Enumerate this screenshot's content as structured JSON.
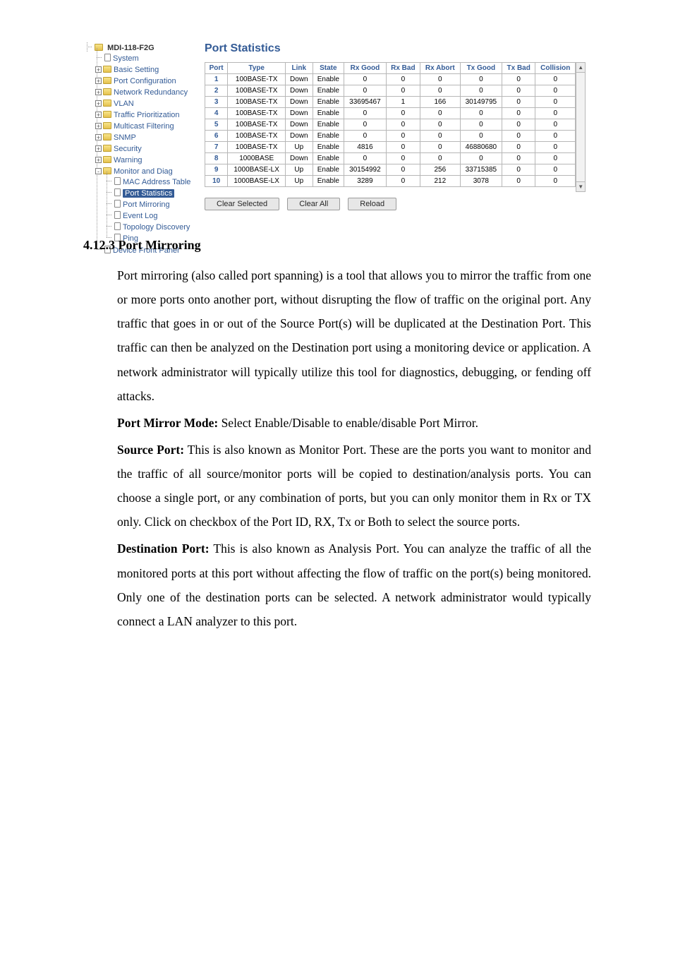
{
  "ui": {
    "product": "MDI-118-F2G",
    "title": "Port Statistics",
    "tree": {
      "root": "MDI-118-F2G",
      "items": [
        {
          "label": "System",
          "icon": "doc"
        },
        {
          "label": "Basic Setting",
          "icon": "folder",
          "exp": "+"
        },
        {
          "label": "Port Configuration",
          "icon": "folder",
          "exp": "+"
        },
        {
          "label": "Network Redundancy",
          "icon": "folder",
          "exp": "+"
        },
        {
          "label": "VLAN",
          "icon": "folder",
          "exp": "+"
        },
        {
          "label": "Traffic Prioritization",
          "icon": "folder",
          "exp": "+"
        },
        {
          "label": "Multicast Filtering",
          "icon": "folder",
          "exp": "+"
        },
        {
          "label": "SNMP",
          "icon": "folder",
          "exp": "+"
        },
        {
          "label": "Security",
          "icon": "folder",
          "exp": "+"
        },
        {
          "label": "Warning",
          "icon": "folder",
          "exp": "+"
        },
        {
          "label": "Monitor and Diag",
          "icon": "folder",
          "exp": "-",
          "children": [
            {
              "label": "MAC Address Table",
              "icon": "doc"
            },
            {
              "label": "Port Statistics",
              "icon": "doc",
              "selected": true
            },
            {
              "label": "Port Mirroring",
              "icon": "doc"
            },
            {
              "label": "Event Log",
              "icon": "doc"
            },
            {
              "label": "Topology Discovery",
              "icon": "doc"
            },
            {
              "label": "Ping",
              "icon": "doc"
            }
          ]
        },
        {
          "label": "Device Front Panel",
          "icon": "doc"
        }
      ]
    },
    "columns": [
      "Port",
      "Type",
      "Link",
      "State",
      "Rx Good",
      "Rx Bad",
      "Rx Abort",
      "Tx Good",
      "Tx Bad",
      "Collision"
    ],
    "rows": [
      [
        "1",
        "100BASE-TX",
        "Down",
        "Enable",
        "0",
        "0",
        "0",
        "0",
        "0",
        "0"
      ],
      [
        "2",
        "100BASE-TX",
        "Down",
        "Enable",
        "0",
        "0",
        "0",
        "0",
        "0",
        "0"
      ],
      [
        "3",
        "100BASE-TX",
        "Down",
        "Enable",
        "33695467",
        "1",
        "166",
        "30149795",
        "0",
        "0"
      ],
      [
        "4",
        "100BASE-TX",
        "Down",
        "Enable",
        "0",
        "0",
        "0",
        "0",
        "0",
        "0"
      ],
      [
        "5",
        "100BASE-TX",
        "Down",
        "Enable",
        "0",
        "0",
        "0",
        "0",
        "0",
        "0"
      ],
      [
        "6",
        "100BASE-TX",
        "Down",
        "Enable",
        "0",
        "0",
        "0",
        "0",
        "0",
        "0"
      ],
      [
        "7",
        "100BASE-TX",
        "Up",
        "Enable",
        "4816",
        "0",
        "0",
        "46880680",
        "0",
        "0"
      ],
      [
        "8",
        "1000BASE",
        "Down",
        "Enable",
        "0",
        "0",
        "0",
        "0",
        "0",
        "0"
      ],
      [
        "9",
        "1000BASE-LX",
        "Up",
        "Enable",
        "30154992",
        "0",
        "256",
        "33715385",
        "0",
        "0"
      ],
      [
        "10",
        "1000BASE-LX",
        "Up",
        "Enable",
        "3289",
        "0",
        "212",
        "3078",
        "0",
        "0"
      ]
    ],
    "buttons": {
      "clear_selected": "Clear Selected",
      "clear_all": "Clear All",
      "reload": "Reload"
    }
  },
  "doc": {
    "heading": "4.12.3  Port Mirroring",
    "p1": "Port mirroring (also called port spanning) is a tool that allows you to mirror the traffic from one or more ports onto another port, without disrupting the flow of traffic on the original port. Any traffic that goes in or out of the Source Port(s) will be duplicated at the Destination Port. This traffic can then be analyzed on the Destination port using a monitoring device or application. A network administrator will typically utilize this tool for diagnostics, debugging, or fending off attacks.",
    "p2_label": "Port Mirror Mode:",
    "p2_rest": " Select Enable/Disable to enable/disable Port Mirror.",
    "p3_label": "Source Port:",
    "p3_rest": " This is also known as Monitor Port. These are the ports you want to monitor and the traffic of all source/monitor ports will be copied to destination/analysis ports. You can choose a single port, or any combination of ports, but you can only monitor them in Rx or TX only. Click on checkbox of the Port ID, RX, Tx or Both to select the source ports.",
    "p4_label": "Destination Port:",
    "p4_rest": " This is also known as Analysis Port. You can analyze the traffic of all the monitored ports at this port without affecting the flow of traffic on the port(s) being monitored. Only one of the destination ports can be selected. A network administrator would typically connect a LAN analyzer to this port."
  }
}
